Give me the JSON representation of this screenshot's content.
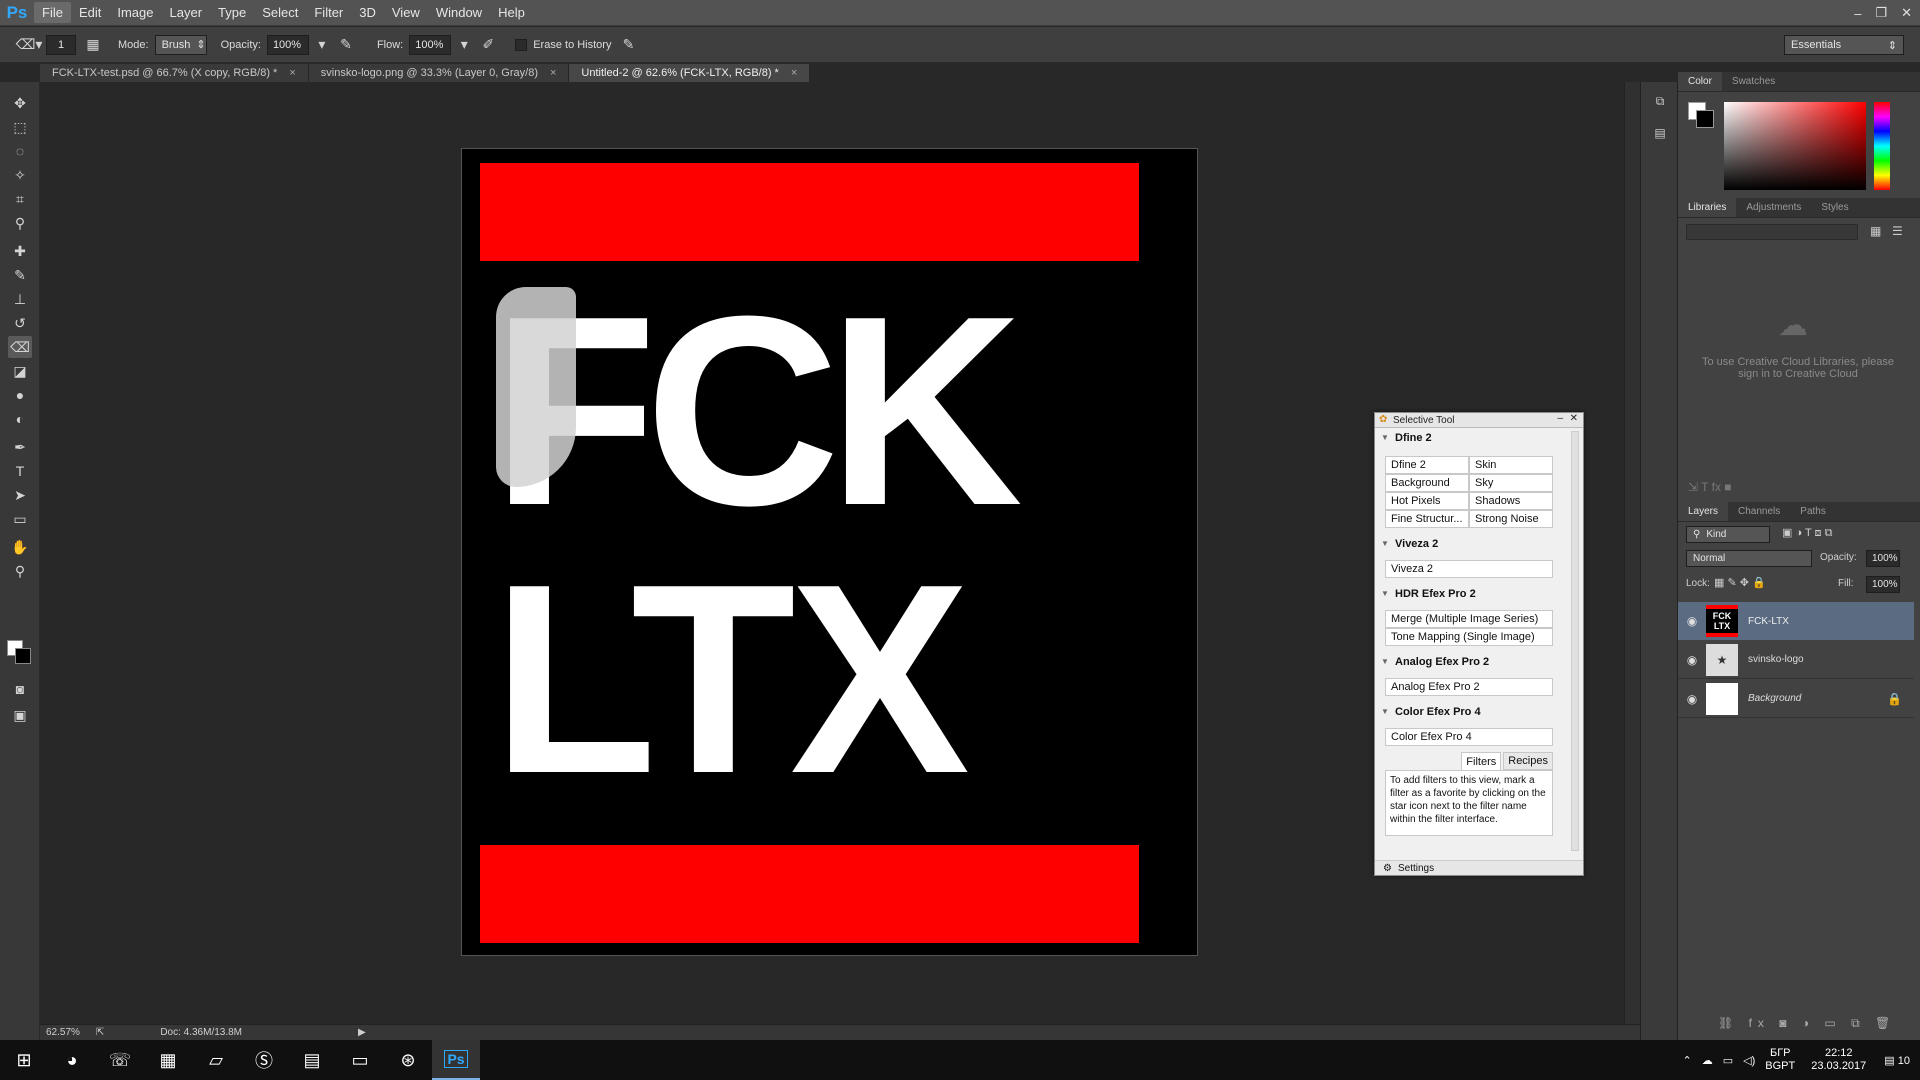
{
  "app": {
    "logo": "Ps"
  },
  "menu": [
    "File",
    "Edit",
    "Image",
    "Layer",
    "Type",
    "Select",
    "Filter",
    "3D",
    "View",
    "Window",
    "Help"
  ],
  "window_controls": [
    "–",
    "❐",
    "✕"
  ],
  "options": {
    "brush_size": "1",
    "mode_label": "Mode:",
    "mode_value": "Brush",
    "opacity_label": "Opacity:",
    "opacity_value": "100%",
    "flow_label": "Flow:",
    "flow_value": "100%",
    "erase_history_label": "Erase to History",
    "workspace": "Essentials"
  },
  "tabs": [
    {
      "label": "FCK-LTX-test.psd @ 66.7% (X copy, RGB/8) *",
      "close": "×"
    },
    {
      "label": "svinsko-logo.png @ 33.3% (Layer 0, Gray/8)",
      "close": "×"
    },
    {
      "label": "Untitled-2 @ 62.6% (FCK-LTX, RGB/8) *",
      "close": "×"
    }
  ],
  "artwork": {
    "line1": "FCK",
    "line2": "LTX",
    "colors": {
      "bar": "#ff0000",
      "bg": "#000000",
      "text": "#ffffff"
    }
  },
  "status": {
    "zoom": "62.57%",
    "doc": "Doc: 4.36M/13.8M"
  },
  "color_panel": {
    "tabs": [
      "Color",
      "Swatches"
    ]
  },
  "libraries_panel": {
    "tabs": [
      "Libraries",
      "Adjustments",
      "Styles"
    ],
    "message": "To use Creative Cloud Libraries, please sign in to Creative Cloud"
  },
  "layers_panel": {
    "tabs": [
      "Layers",
      "Channels",
      "Paths"
    ],
    "kind": "Kind",
    "blend_mode": "Normal",
    "opacity_label": "Opacity:",
    "opacity_value": "100%",
    "lock_label": "Lock:",
    "fill_label": "Fill:",
    "fill_value": "100%",
    "layers": [
      {
        "name": "FCK-LTX",
        "thumb": "FCK LTX"
      },
      {
        "name": "svinsko-logo"
      },
      {
        "name": "Background"
      }
    ]
  },
  "selective_tool": {
    "title": "Selective Tool",
    "sections": [
      {
        "name": "Dfine 2",
        "items": [
          "Dfine 2",
          "Skin",
          "Background",
          "Sky",
          "Hot Pixels",
          "Shadows",
          "Fine Structur...",
          "Strong Noise"
        ]
      },
      {
        "name": "Viveza 2",
        "items": [
          "Viveza 2"
        ]
      },
      {
        "name": "HDR Efex Pro 2",
        "items": [
          "Merge (Multiple Image Series)",
          "Tone Mapping (Single Image)"
        ]
      },
      {
        "name": "Analog Efex Pro 2",
        "items": [
          "Analog Efex Pro 2"
        ]
      },
      {
        "name": "Color Efex Pro 4",
        "items": [
          "Color Efex Pro 4"
        ]
      }
    ],
    "bottom_tabs": [
      "Filters",
      "Recipes"
    ],
    "info": "To add filters to this view, mark a filter as a favorite by clicking on the star icon next to the filter name within the filter interface.",
    "settings": "Settings"
  },
  "taskbar": {
    "lang": "БГР",
    "lang2": "BGPT",
    "time": "22:12",
    "date": "23.03.2017",
    "notif": "10"
  }
}
